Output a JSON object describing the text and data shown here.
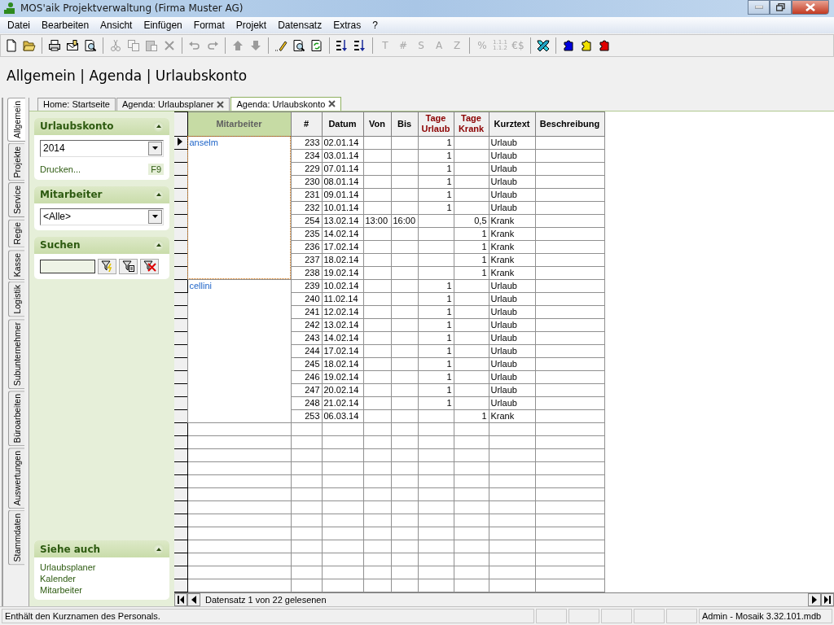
{
  "window": {
    "title": "MOS'aik Projektverwaltung (Firma Muster AG)"
  },
  "menu": [
    {
      "label": "Datei"
    },
    {
      "label": "Bearbeiten"
    },
    {
      "label": "Ansicht"
    },
    {
      "label": "Einfügen"
    },
    {
      "label": "Format"
    },
    {
      "label": "Projekt"
    },
    {
      "label": "Datensatz"
    },
    {
      "label": "Extras"
    },
    {
      "label": "?"
    }
  ],
  "toolbar": [
    [
      {
        "disabled": false
      },
      {
        "disabled": false
      }
    ],
    [
      {
        "disabled": false
      },
      {
        "disabled": false
      },
      {
        "disabled": false
      }
    ],
    [
      {
        "disabled": true
      },
      {
        "disabled": true
      },
      {
        "disabled": true
      },
      {
        "disabled": true
      }
    ],
    [
      {
        "disabled": true
      },
      {
        "disabled": true
      }
    ],
    [
      {
        "disabled": true
      },
      {
        "disabled": true
      }
    ],
    [
      {
        "disabled": false
      },
      {
        "disabled": false
      },
      {
        "disabled": false
      }
    ],
    [
      {
        "disabled": false
      },
      {
        "disabled": false
      }
    ],
    [
      {
        "label": "T",
        "disabled": true
      },
      {
        "label": "#",
        "disabled": true
      },
      {
        "label": "S",
        "disabled": true
      },
      {
        "label": "A",
        "disabled": true
      },
      {
        "label": "Z",
        "disabled": true
      }
    ],
    [
      {
        "label": "%",
        "disabled": true
      },
      {
        "label": "1.1.1 1.1.2",
        "disabled": true
      },
      {
        "label": "€$",
        "disabled": true
      }
    ],
    [
      {
        "disabled": false
      }
    ],
    [
      {
        "disabled": false,
        "color": "#0000e0"
      },
      {
        "disabled": false,
        "color": "#f0e000"
      },
      {
        "disabled": false,
        "color": "#e00000"
      }
    ]
  ],
  "breadcrumb": "Allgemein | Agenda | Urlaubskonto",
  "side_tabs": [
    {
      "label": "Allgemein",
      "selected": true
    },
    {
      "label": "Projekte",
      "selected": false
    },
    {
      "label": "Service",
      "selected": false
    },
    {
      "label": "Regie",
      "selected": false
    },
    {
      "label": "Kasse",
      "selected": false
    },
    {
      "label": "Logistik",
      "selected": false
    },
    {
      "label": "Subunternehmer",
      "selected": false
    },
    {
      "label": "Büroarbeiten",
      "selected": false
    },
    {
      "label": "Auswertungen",
      "selected": false
    },
    {
      "label": "Stammdaten",
      "selected": false
    }
  ],
  "doc_tabs": [
    {
      "label": "Home: Startseite",
      "closable": false,
      "selected": false
    },
    {
      "label": "Agenda: Urlaubsplaner",
      "closable": true,
      "selected": false
    },
    {
      "label": "Agenda: Urlaubskonto",
      "closable": true,
      "selected": true
    }
  ],
  "panel": {
    "urlaubskonto": {
      "title": "Urlaubskonto",
      "year": "2014",
      "print_link": "Drucken...",
      "print_shortcut": "F9"
    },
    "mitarbeiter": {
      "title": "Mitarbeiter",
      "value": "<Alle>"
    },
    "suchen": {
      "title": "Suchen"
    },
    "siehe_auch": {
      "title": "Siehe auch",
      "links": [
        "Urlaubsplaner",
        "Kalender",
        "Mitarbeiter"
      ]
    }
  },
  "table": {
    "columns": [
      {
        "label": "Mitarbeiter",
        "sorted": true,
        "color": "#606060"
      },
      {
        "label": "#",
        "sorted": false,
        "color": "#000000"
      },
      {
        "label": "Datum",
        "sorted": false,
        "color": "#000000"
      },
      {
        "label": "Von",
        "sorted": false,
        "color": "#000000"
      },
      {
        "label": "Bis",
        "sorted": false,
        "color": "#000000"
      },
      {
        "label": "Tage Urlaub",
        "sorted": false,
        "color": "#8b0000"
      },
      {
        "label": "Tage Krank",
        "sorted": false,
        "color": "#8b0000"
      },
      {
        "label": "Kurztext",
        "sorted": false,
        "color": "#000000"
      },
      {
        "label": "Beschreibung",
        "sorted": false,
        "color": "#000000"
      }
    ],
    "groups": [
      {
        "mitarbeiter": "anselm",
        "selected": true,
        "rows": [
          {
            "nr": "233",
            "datum": "02.01.14",
            "tage_urlaub": "1",
            "kurztext": "Urlaub"
          },
          {
            "nr": "234",
            "datum": "03.01.14",
            "tage_urlaub": "1",
            "kurztext": "Urlaub"
          },
          {
            "nr": "229",
            "datum": "07.01.14",
            "tage_urlaub": "1",
            "kurztext": "Urlaub"
          },
          {
            "nr": "230",
            "datum": "08.01.14",
            "tage_urlaub": "1",
            "kurztext": "Urlaub"
          },
          {
            "nr": "231",
            "datum": "09.01.14",
            "tage_urlaub": "1",
            "kurztext": "Urlaub"
          },
          {
            "nr": "232",
            "datum": "10.01.14",
            "tage_urlaub": "1",
            "kurztext": "Urlaub"
          },
          {
            "nr": "254",
            "datum": "13.02.14",
            "von": "13:00",
            "bis": "16:00",
            "tage_krank": "0,5",
            "kurztext": "Krank"
          },
          {
            "nr": "235",
            "datum": "14.02.14",
            "tage_krank": "1",
            "kurztext": "Krank"
          },
          {
            "nr": "236",
            "datum": "17.02.14",
            "tage_krank": "1",
            "kurztext": "Krank"
          },
          {
            "nr": "237",
            "datum": "18.02.14",
            "tage_krank": "1",
            "kurztext": "Krank"
          },
          {
            "nr": "238",
            "datum": "19.02.14",
            "tage_krank": "1",
            "kurztext": "Krank"
          }
        ]
      },
      {
        "mitarbeiter": "cellini",
        "selected": false,
        "rows": [
          {
            "nr": "239",
            "datum": "10.02.14",
            "tage_urlaub": "1",
            "kurztext": "Urlaub"
          },
          {
            "nr": "240",
            "datum": "11.02.14",
            "tage_urlaub": "1",
            "kurztext": "Urlaub"
          },
          {
            "nr": "241",
            "datum": "12.02.14",
            "tage_urlaub": "1",
            "kurztext": "Urlaub"
          },
          {
            "nr": "242",
            "datum": "13.02.14",
            "tage_urlaub": "1",
            "kurztext": "Urlaub"
          },
          {
            "nr": "243",
            "datum": "14.02.14",
            "tage_urlaub": "1",
            "kurztext": "Urlaub"
          },
          {
            "nr": "244",
            "datum": "17.02.14",
            "tage_urlaub": "1",
            "kurztext": "Urlaub"
          },
          {
            "nr": "245",
            "datum": "18.02.14",
            "tage_urlaub": "1",
            "kurztext": "Urlaub"
          },
          {
            "nr": "246",
            "datum": "19.02.14",
            "tage_urlaub": "1",
            "kurztext": "Urlaub"
          },
          {
            "nr": "247",
            "datum": "20.02.14",
            "tage_urlaub": "1",
            "kurztext": "Urlaub"
          },
          {
            "nr": "248",
            "datum": "21.02.14",
            "tage_urlaub": "1",
            "kurztext": "Urlaub"
          },
          {
            "nr": "253",
            "datum": "06.03.14",
            "tage_krank": "1",
            "kurztext": "Krank"
          }
        ]
      }
    ],
    "navigator": "Datensatz 1 von 22 gelesenen"
  },
  "status_bar": {
    "message": "Enthält den Kurznamen des Personals.",
    "database": "Admin - Mosaik 3.32.101.mdb"
  }
}
